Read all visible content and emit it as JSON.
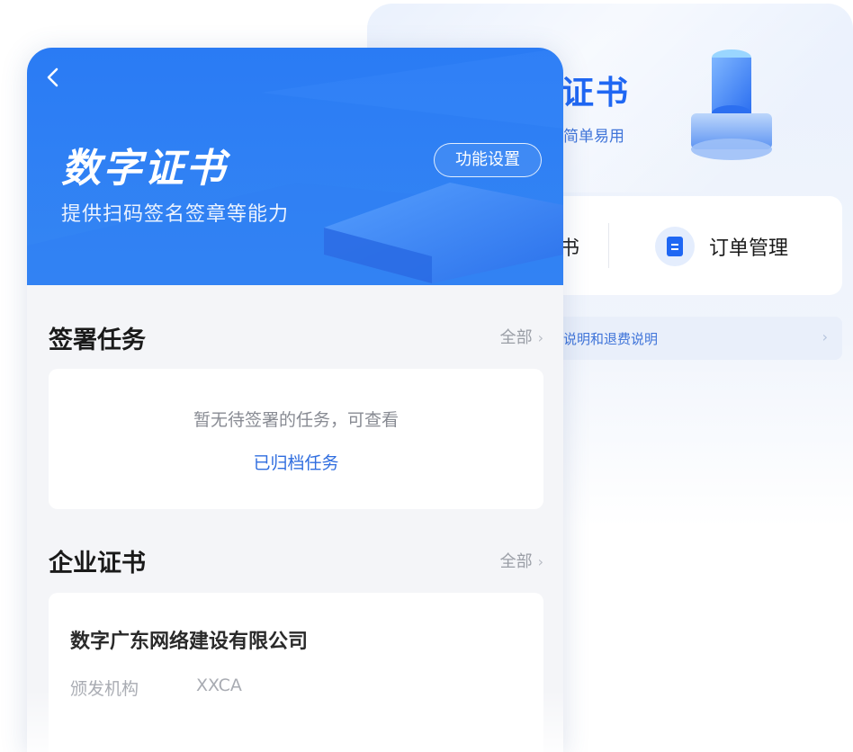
{
  "back_screen": {
    "title_partial": "证书",
    "subtitle_partial": "简单易用",
    "menu": {
      "left_item_partial": "书",
      "order_label": "订单管理",
      "order_icon": "document-icon"
    },
    "notice": {
      "text_partial": "说明和退费说明"
    }
  },
  "front_screen": {
    "header": {
      "back_icon": "chevron-left-icon",
      "title": "数字证书",
      "subtitle": "提供扫码签名签章等能力",
      "settings_label": "功能设置"
    },
    "sign_tasks": {
      "title": "签署任务",
      "more_label": "全部",
      "empty_text": "暂无待签署的任务，可查看",
      "archived_link": "已归档任务"
    },
    "enterprise_certs": {
      "title": "企业证书",
      "more_label": "全部",
      "items": [
        {
          "company_name": "数字广东网络建设有限公司",
          "issuer_label": "颁发机构",
          "issuer_value": "XXCA"
        }
      ]
    }
  },
  "colors": {
    "primary_blue": "#2a7bf4",
    "link_blue": "#2f6ddf",
    "page_bg": "#f4f5f8"
  }
}
